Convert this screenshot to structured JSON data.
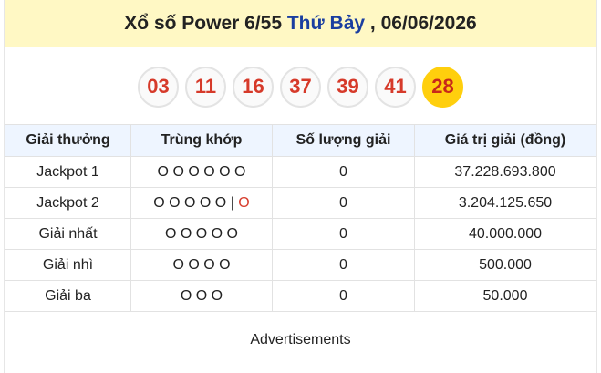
{
  "header": {
    "prefix": "Xổ số Power 6/55 ",
    "day": "Thứ Bảy",
    "suffix": " , 06/06/2026"
  },
  "numbers": [
    "03",
    "11",
    "16",
    "37",
    "39",
    "41"
  ],
  "power_number": "28",
  "table": {
    "columns": [
      "Giải thưởng",
      "Trùng khớp",
      "Số lượng giải",
      "Giá trị giải (đồng)"
    ],
    "rows": [
      {
        "prize": "Jackpot 1",
        "match": "O O O O O O",
        "match_extra": "",
        "count": "0",
        "value": "37.228.693.800"
      },
      {
        "prize": "Jackpot 2",
        "match": "O O O O O | ",
        "match_extra": "O",
        "count": "0",
        "value": "3.204.125.650"
      },
      {
        "prize": "Giải nhất",
        "match": "O O O O O",
        "match_extra": "",
        "count": "0",
        "value": "40.000.000"
      },
      {
        "prize": "Giải nhì",
        "match": "O O O O",
        "match_extra": "",
        "count": "0",
        "value": "500.000"
      },
      {
        "prize": "Giải ba",
        "match": "O O O",
        "match_extra": "",
        "count": "0",
        "value": "50.000"
      }
    ]
  },
  "ads_label": "Advertisements",
  "colors": {
    "header_bg": "#fff8c4",
    "day_text": "#1a3ea0",
    "ball_text": "#d63a2a",
    "power_ball_bg": "#ffcf0d",
    "table_header_bg": "#eef5ff"
  }
}
